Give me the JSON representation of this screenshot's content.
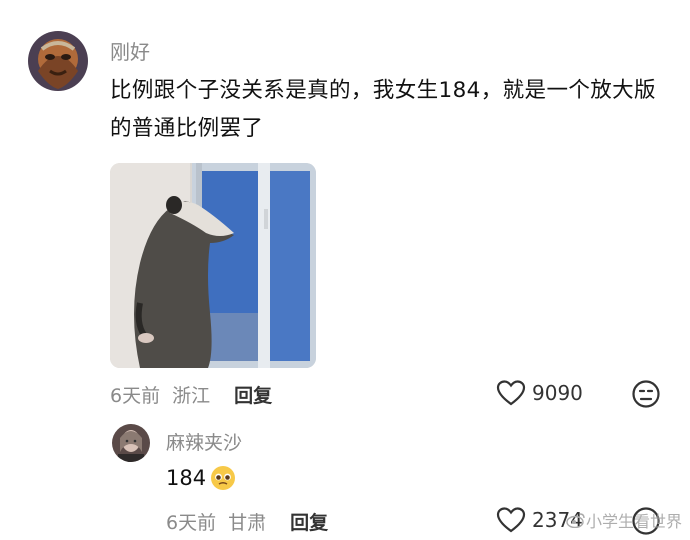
{
  "comment": {
    "username": "刚好",
    "text": "比例跟个子没关系是真的，我女生184，就是一个放大版的普通比例罢了",
    "time": "6天前",
    "location": "浙江",
    "reply_label": "回复",
    "likes": "9090"
  },
  "reply": {
    "username": "麻辣夹沙",
    "text": "184",
    "time": "6天前",
    "location": "甘肃",
    "reply_label": "回复",
    "likes": "2374"
  },
  "watermark": {
    "text": "小学生看世界"
  },
  "icons": [
    "heart-icon",
    "unamused-face-icon",
    "pleading-face-emoji",
    "weibo-icon"
  ]
}
